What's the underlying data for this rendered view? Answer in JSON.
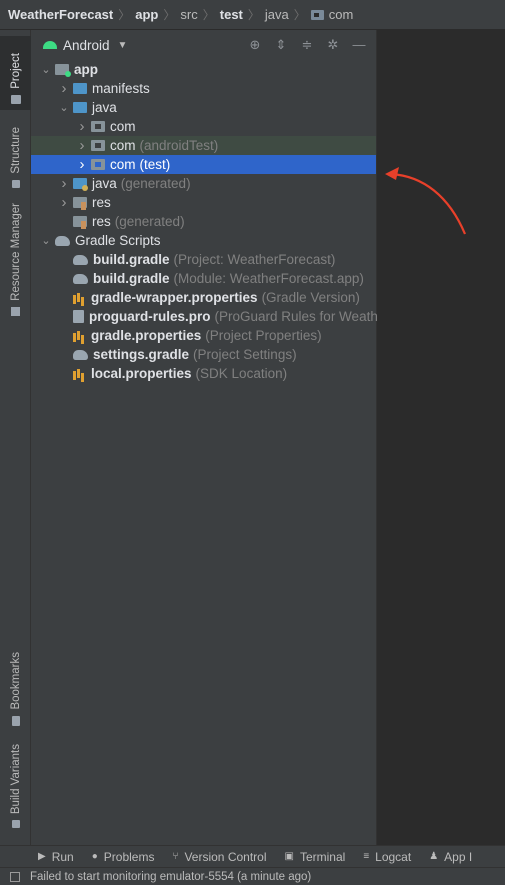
{
  "breadcrumb": [
    {
      "label": "WeatherForecast",
      "bold": true
    },
    {
      "label": "app",
      "bold": true
    },
    {
      "label": "src",
      "bold": false
    },
    {
      "label": "test",
      "bold": true
    },
    {
      "label": "java",
      "bold": false
    },
    {
      "label": "com",
      "bold": false,
      "icon": "package-folder-icon"
    }
  ],
  "left_stripe": {
    "tabs": [
      {
        "label": "Project",
        "icon": "folder-icon",
        "active": true
      },
      {
        "label": "Structure",
        "icon": "structure-icon",
        "active": false
      },
      {
        "label": "Resource Manager",
        "icon": "resource-manager-icon",
        "active": false
      },
      {
        "label": "Bookmarks",
        "icon": "bookmark-icon",
        "active": false
      },
      {
        "label": "Build Variants",
        "icon": "build-variants-icon",
        "active": false
      }
    ]
  },
  "panel": {
    "view_label": "Android",
    "view_icon": "android-icon",
    "tools": [
      "crosshair-icon",
      "expand-all-icon",
      "collapse-all-icon",
      "gear-icon",
      "minimize-icon"
    ]
  },
  "tree": [
    {
      "depth": 0,
      "chevron": "down",
      "icon": "app-module",
      "name": "app",
      "bold": true,
      "hint": ""
    },
    {
      "depth": 1,
      "chevron": "right",
      "icon": "folder-blue",
      "name": "manifests",
      "bold": false,
      "hint": ""
    },
    {
      "depth": 1,
      "chevron": "down",
      "icon": "folder-blue",
      "name": "java",
      "bold": false,
      "hint": ""
    },
    {
      "depth": 2,
      "chevron": "right",
      "icon": "package",
      "name": "com",
      "bold": false,
      "hint": ""
    },
    {
      "depth": 2,
      "chevron": "right",
      "icon": "package",
      "name": "com",
      "bold": false,
      "hint": "(androidTest)",
      "state": "highlighted"
    },
    {
      "depth": 2,
      "chevron": "right",
      "icon": "package",
      "name": "com",
      "bold": false,
      "hint": "(test)",
      "state": "selected"
    },
    {
      "depth": 1,
      "chevron": "right",
      "icon": "folder-generated",
      "name": "java",
      "bold": false,
      "hint": "(generated)"
    },
    {
      "depth": 1,
      "chevron": "right",
      "icon": "folder-res",
      "name": "res",
      "bold": false,
      "hint": ""
    },
    {
      "depth": 1,
      "chevron": "none",
      "icon": "folder-res",
      "name": "res",
      "bold": false,
      "hint": "(generated)"
    },
    {
      "depth": 0,
      "chevron": "down",
      "icon": "gradle",
      "name": "Gradle Scripts",
      "bold": false,
      "hint": ""
    },
    {
      "depth": 1,
      "chevron": "none",
      "icon": "gradle",
      "name": "build.gradle",
      "bold": true,
      "hint": "(Project: WeatherForecast)"
    },
    {
      "depth": 1,
      "chevron": "none",
      "icon": "gradle",
      "name": "build.gradle",
      "bold": true,
      "hint": "(Module: WeatherForecast.app)"
    },
    {
      "depth": 1,
      "chevron": "none",
      "icon": "properties",
      "name": "gradle-wrapper.properties",
      "bold": true,
      "hint": "(Gradle Version)"
    },
    {
      "depth": 1,
      "chevron": "none",
      "icon": "document",
      "name": "proguard-rules.pro",
      "bold": true,
      "hint": "(ProGuard Rules for Weath"
    },
    {
      "depth": 1,
      "chevron": "none",
      "icon": "properties",
      "name": "gradle.properties",
      "bold": true,
      "hint": "(Project Properties)"
    },
    {
      "depth": 1,
      "chevron": "none",
      "icon": "gradle",
      "name": "settings.gradle",
      "bold": true,
      "hint": "(Project Settings)"
    },
    {
      "depth": 1,
      "chevron": "none",
      "icon": "properties",
      "name": "local.properties",
      "bold": true,
      "hint": "(SDK Location)"
    }
  ],
  "bottom_tabs": [
    {
      "label": "Run",
      "icon": "play-icon"
    },
    {
      "label": "Problems",
      "icon": "problems-icon"
    },
    {
      "label": "Version Control",
      "icon": "version-control-icon"
    },
    {
      "label": "Terminal",
      "icon": "terminal-icon"
    },
    {
      "label": "Logcat",
      "icon": "logcat-icon"
    },
    {
      "label": "App I",
      "icon": "app-inspection-icon"
    }
  ],
  "status": {
    "message": "Failed to start monitoring emulator-5554 (a minute ago)"
  },
  "colors": {
    "selection": "#2f65ca",
    "annotation_arrow": "#e8402a"
  }
}
